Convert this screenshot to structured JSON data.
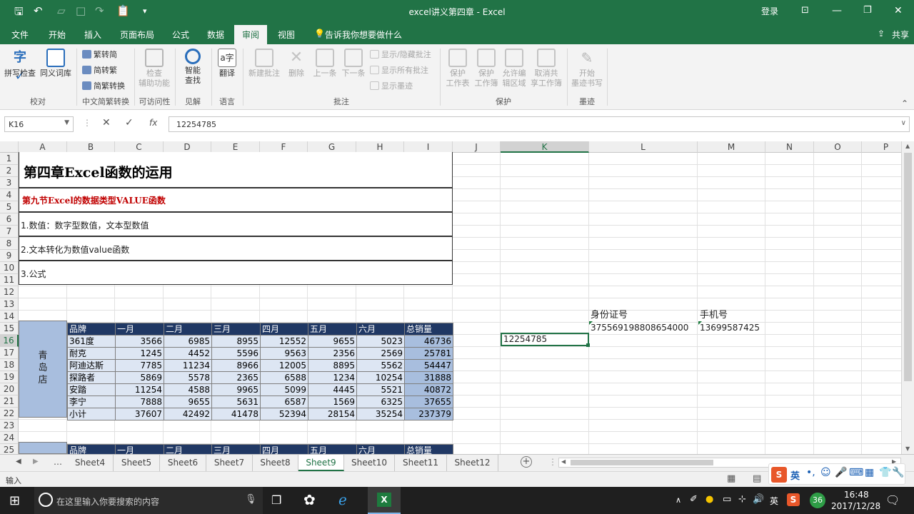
{
  "window": {
    "title": "excel讲义第四章 - Excel",
    "login": "登录"
  },
  "tabs": [
    "文件",
    "开始",
    "插入",
    "页面布局",
    "公式",
    "数据",
    "审阅",
    "视图"
  ],
  "tell_me": "告诉我你想要做什么",
  "share": "共享",
  "ribbon": {
    "spell": "拼写检查",
    "thesaurus": "同义词库",
    "proof_group": "校对",
    "to_trad": "繁转简",
    "to_simp": "简转繁",
    "convert": "简繁转换",
    "cn_group": "中文简繁转换",
    "access_check_1": "检查",
    "access_check_2": "辅助功能",
    "access_group": "可访问性",
    "smart_1": "智能",
    "smart_2": "查找",
    "insights_group": "见解",
    "translate": "翻译",
    "lang_group": "语言",
    "new_comment": "新建批注",
    "delete": "删除",
    "prev": "上一条",
    "next": "下一条",
    "show_hide": "显示/隐藏批注",
    "show_all": "显示所有批注",
    "show_ink": "显示墨迹",
    "comments_group": "批注",
    "protect_sheet_1": "保护",
    "protect_sheet_2": "工作表",
    "protect_wb_1": "保护",
    "protect_wb_2": "工作簿",
    "allow_edit_1": "允许编",
    "allow_edit_2": "辑区域",
    "unshare_1": "取消共",
    "unshare_2": "享工作簿",
    "protect_group": "保护",
    "ink_1": "开始",
    "ink_2": "墨迹书写",
    "ink_group": "墨迹"
  },
  "formula_bar": {
    "name_box": "K16",
    "formula": "12254785",
    "fx": "fx"
  },
  "columns": [
    "A",
    "B",
    "C",
    "D",
    "E",
    "F",
    "G",
    "H",
    "I",
    "J",
    "K",
    "L",
    "M",
    "N",
    "O",
    "P"
  ],
  "rows": [
    "1",
    "2",
    "3",
    "4",
    "5",
    "6",
    "7",
    "8",
    "9",
    "10",
    "11",
    "12",
    "13",
    "14",
    "15",
    "16",
    "17",
    "18",
    "19",
    "20",
    "21",
    "22",
    "23",
    "24",
    "25"
  ],
  "content": {
    "chapter_title": "第四章Excel函数的运用",
    "section_title": "第九节Excel的数据类型VALUE函数",
    "item1": "1.数值：数字型数值，文本型数值",
    "item2": "2.文本转化为数值value函数",
    "item3": "3.公式"
  },
  "sales_table": {
    "store": "青岛店",
    "headers": [
      "品牌",
      "一月",
      "二月",
      "三月",
      "四月",
      "五月",
      "六月",
      "总销量"
    ],
    "rows": [
      [
        "361度",
        "3566",
        "6985",
        "8955",
        "12552",
        "9655",
        "5023",
        "46736"
      ],
      [
        "耐克",
        "1245",
        "4452",
        "5596",
        "9563",
        "2356",
        "2569",
        "25781"
      ],
      [
        "阿迪达斯",
        "7785",
        "11234",
        "8966",
        "12005",
        "8895",
        "5562",
        "54447"
      ],
      [
        "探路者",
        "5869",
        "5578",
        "2365",
        "6588",
        "1234",
        "10254",
        "31888"
      ],
      [
        "安踏",
        "11254",
        "4588",
        "9965",
        "5099",
        "4445",
        "5521",
        "40872"
      ],
      [
        "李宁",
        "7888",
        "9655",
        "5631",
        "6587",
        "1569",
        "6325",
        "37655"
      ],
      [
        "小计",
        "37607",
        "42492",
        "41478",
        "52394",
        "28154",
        "35254",
        "237379"
      ]
    ]
  },
  "side": {
    "id_label": "身份证号",
    "id_value": "375569198808654000",
    "phone_label": "手机号",
    "phone_value": "13699587425",
    "active_value": "12254785"
  },
  "sheet_tabs": [
    "Sheet4",
    "Sheet5",
    "Sheet6",
    "Sheet7",
    "Sheet8",
    "Sheet9",
    "Sheet10",
    "Sheet11",
    "Sheet12"
  ],
  "active_sheet": "Sheet9",
  "status_text": "输入",
  "taskbar": {
    "search": "在这里输入你要搜索的内容",
    "time": "16:48",
    "date": "2017/12/28",
    "ime": "英",
    "badge": "36"
  },
  "colors": {
    "excel_green": "#217346",
    "table_header": "#203864",
    "table_row": "#dde6f3",
    "store_cell": "#a8bede",
    "red_text": "#c00000"
  }
}
